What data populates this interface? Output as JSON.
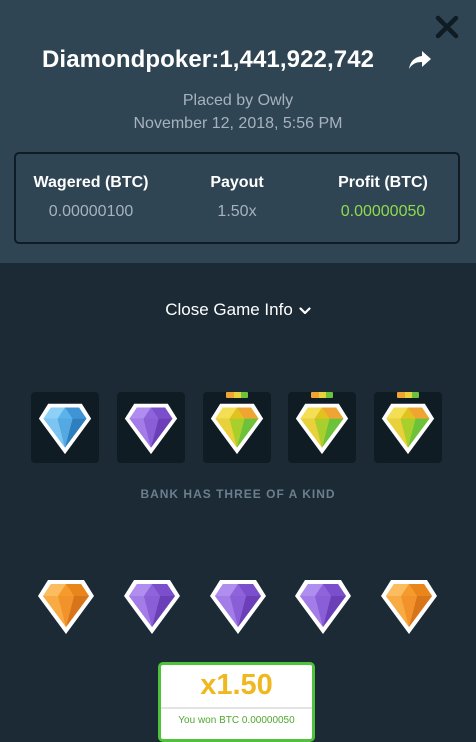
{
  "header": {
    "bet_title": "Diamondpoker:1,441,922,742",
    "placed_by": "Placed by Owly",
    "placed_date": "November 12, 2018, 5:56 PM",
    "close_icon": "close-icon",
    "share_icon": "share-icon"
  },
  "stats": {
    "wagered_label": "Wagered (BTC)",
    "wagered_value": "0.00000100",
    "payout_label": "Payout",
    "payout_value": "1.50x",
    "profit_label": "Profit (BTC)",
    "profit_value": "0.00000050"
  },
  "game_info_toggle": {
    "label": "Close Game Info",
    "icon": "chevron-down-icon"
  },
  "bank": {
    "gems": [
      "blue",
      "purple",
      "yellow",
      "yellow",
      "yellow"
    ],
    "winning": [
      false,
      false,
      true,
      true,
      true
    ],
    "result_label": "BANK HAS THREE OF A KIND"
  },
  "player": {
    "gems": [
      "orange",
      "purple",
      "purple",
      "purple",
      "orange"
    ]
  },
  "result": {
    "multiplier": "x1.50",
    "message": "You won BTC 0.00000050"
  },
  "colors": {
    "top_panel": "#2f4553",
    "background": "#1b2a35",
    "card": "#0f1c24",
    "profit_green": "#8ddb4f",
    "win_border": "#4fc23b",
    "multiplier": "#f0b81f",
    "gem_blue": "#5bb3ec",
    "gem_purple": "#8f63d9",
    "gem_yellow": "#e2c21f",
    "gem_orange": "#f59a2b"
  }
}
